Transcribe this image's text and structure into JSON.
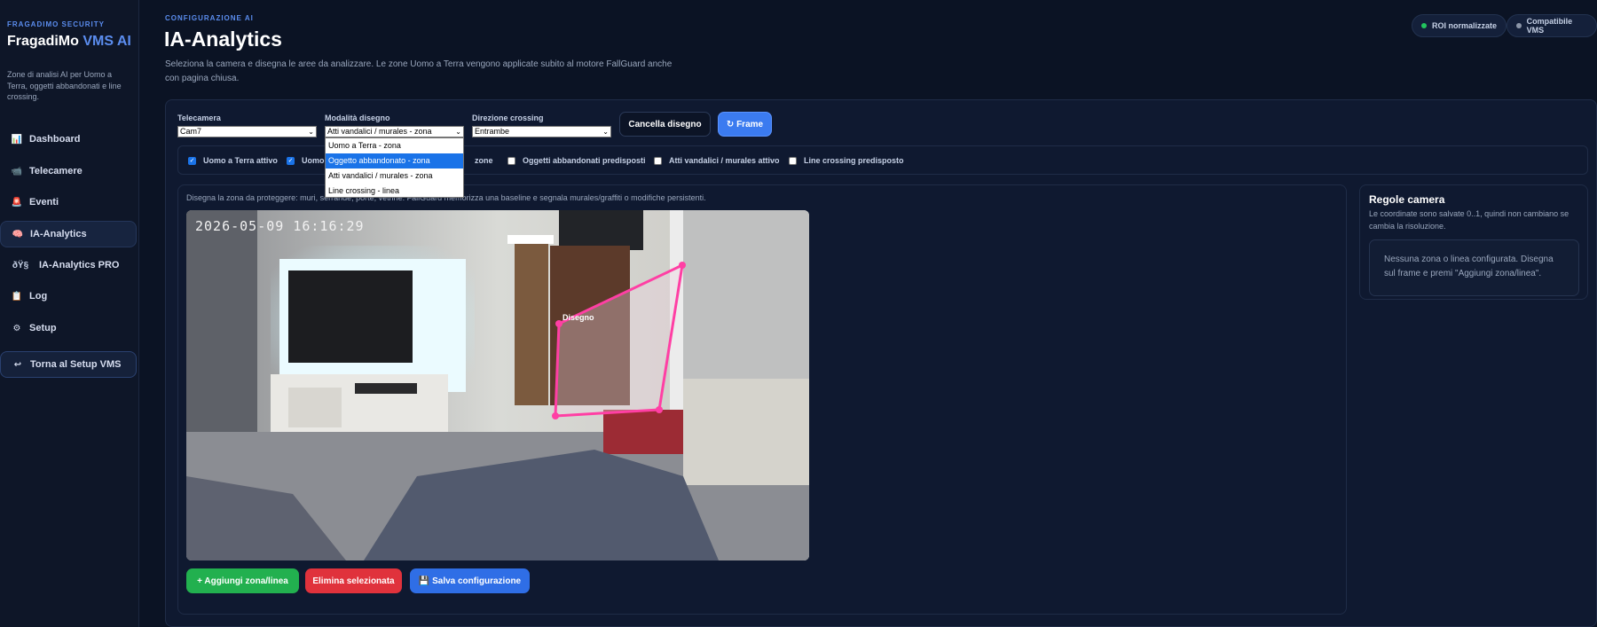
{
  "sidebar": {
    "kicker": "FRAGADIMO SECURITY",
    "title_main": "FragadiMo",
    "title_accent": "VMS AI",
    "description": "Zone di analisi AI per Uomo a Terra, oggetti abbandonati e line crossing.",
    "items": [
      {
        "label": "Dashboard",
        "icon": "📊"
      },
      {
        "label": "Telecamere",
        "icon": "📹"
      },
      {
        "label": "Eventi",
        "icon": "🚨"
      },
      {
        "label": "IA-Analytics",
        "icon": "🧠"
      },
      {
        "label": "IA-Analytics PRO",
        "icon": "ðŸ§"
      },
      {
        "label": "Log",
        "icon": "📋"
      },
      {
        "label": "Setup",
        "icon": "⚙"
      }
    ],
    "back": {
      "label": "Torna al Setup VMS",
      "icon": "↩"
    }
  },
  "header": {
    "kicker": "CONFIGURAZIONE AI",
    "title": "IA-Analytics",
    "description": "Seleziona la camera e disegna le aree da analizzare. Le zone Uomo a Terra vengono applicate subito al motore FallGuard anche con pagina chiusa.",
    "badges": [
      {
        "label": "ROI normalizzate",
        "color": "#22c55e"
      },
      {
        "label": "Compatibile VMS",
        "color": "#8b95a7"
      }
    ]
  },
  "controls": {
    "camera": {
      "label": "Telecamera",
      "value": "Cam7"
    },
    "mode": {
      "label": "Modalità disegno",
      "value": "Atti vandalici / murales - zona",
      "options": [
        "Uomo a Terra - zona",
        "Oggetto abbandonato - zona",
        "Atti vandalici / murales - zona",
        "Line crossing - linea"
      ]
    },
    "direction": {
      "label": "Direzione crossing",
      "value": "Entrambe"
    },
    "clear_button": "Cancella disegno",
    "frame_button": "↻ Frame"
  },
  "checks": [
    {
      "label": "Uomo a Terra attivo",
      "checked": true
    },
    {
      "label": "Uomo",
      "checked": true
    },
    {
      "label": "zone",
      "checked": false
    },
    {
      "label": "Oggetti abbandonati predisposti",
      "checked": false
    },
    {
      "label": "Atti vandalici / murales attivo",
      "checked": false
    },
    {
      "label": "Line crossing predisposto",
      "checked": false
    }
  ],
  "canvas": {
    "hint": "Disegna la zona da proteggere: muri, serrande, porte, vetrine. FallGuard memorizza una baseline e segnala murales/graffiti o modifiche persistenti.",
    "timestamp": "2026-05-09 16:16:29",
    "polygon_label": "Disegno"
  },
  "actions": {
    "add": "+ Aggiungi zona/linea",
    "delete": "Elimina selezionata",
    "save": "💾 Salva configurazione"
  },
  "rules": {
    "title": "Regole camera",
    "description": "Le coordinate sono salvate 0..1, quindi non cambiano se cambia la risoluzione.",
    "empty": "Nessuna zona o linea configurata. Disegna sul frame e premi \"Aggiungi zona/linea\"."
  }
}
